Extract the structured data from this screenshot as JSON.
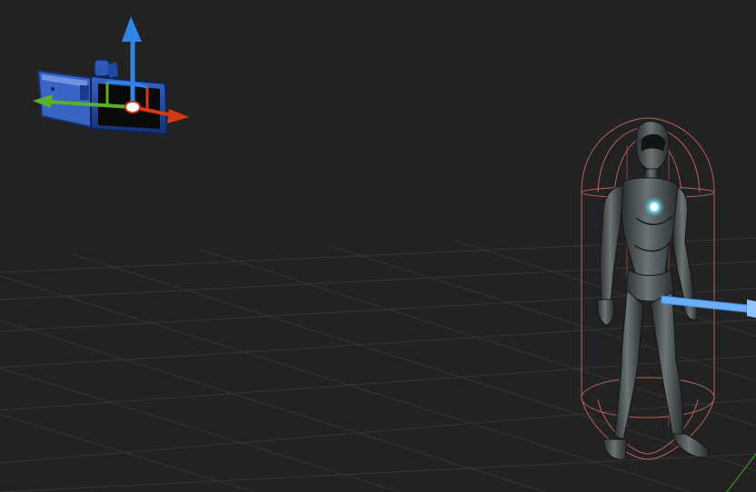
{
  "viewport": {
    "background": "#222222",
    "grid_color": "#353535",
    "axis_colors": {
      "x": "#c0391b",
      "y": "#5fae22",
      "z": "#2f7de0"
    }
  },
  "camera": {
    "icon": "camera-icon",
    "body_color": "#1f47a6",
    "side_color": "#3a64c4",
    "gizmo": {
      "icon": "transform-gizmo-icon",
      "x_color": "#d23a16",
      "y_color": "#59b02a",
      "z_color": "#2f86e6"
    }
  },
  "character": {
    "icon": "humanoid-character-icon",
    "body_color": "#3b4142",
    "core_glow_color": "#7fe8ff",
    "collision_capsule": {
      "icon": "capsule-collider-icon",
      "color": "#b9605f"
    },
    "direction_arrow": {
      "icon": "forward-arrow-icon",
      "color": "#6aaef7"
    }
  }
}
